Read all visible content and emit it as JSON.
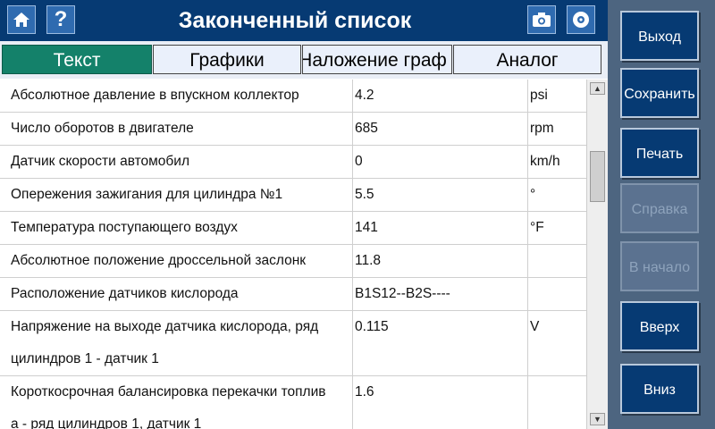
{
  "header": {
    "title": "Законченный список",
    "home_icon": "home-icon",
    "help_label": "?",
    "camera_icon": "camera-icon",
    "disc_icon": "disc-icon"
  },
  "tabs": [
    {
      "label": "Текст",
      "active": true
    },
    {
      "label": "Графики",
      "active": false
    },
    {
      "label": "Наложение граф",
      "active": false
    },
    {
      "label": "Аналог",
      "active": false
    }
  ],
  "rows": [
    {
      "name": [
        "Абсолютное давление в впускном коллектор"
      ],
      "value": "4.2",
      "unit": "psi"
    },
    {
      "name": [
        "Число оборотов в двигателе"
      ],
      "value": "685",
      "unit": "rpm"
    },
    {
      "name": [
        "Датчик скорости автомобил"
      ],
      "value": "0",
      "unit": "km/h"
    },
    {
      "name": [
        "Опережения зажигания для цилиндра №1"
      ],
      "value": "5.5",
      "unit": "°"
    },
    {
      "name": [
        "Температура поступающего воздух"
      ],
      "value": "141",
      "unit": "°F"
    },
    {
      "name": [
        "Абсолютное положение дроссельной заслонк"
      ],
      "value": "11.8",
      "unit": ""
    },
    {
      "name": [
        "Расположение датчиков кислорода"
      ],
      "value": "B1S12--B2S----",
      "unit": ""
    },
    {
      "name": [
        "Напряжение на выходе датчика кислорода, ряд",
        "цилиндров 1 - датчик 1"
      ],
      "value": "0.115",
      "unit": "V"
    },
    {
      "name": [
        "Короткосрочная балансировка перекачки топлив",
        "а - ряд цилиндров 1, датчик 1"
      ],
      "value": "1.6",
      "unit": ""
    }
  ],
  "side_buttons": [
    {
      "label": "Выход",
      "enabled": true
    },
    {
      "label": "Сохранить",
      "enabled": true
    },
    {
      "label": "Печать",
      "enabled": true
    },
    {
      "label": "Справка",
      "enabled": false
    },
    {
      "label": "В начало",
      "enabled": false
    },
    {
      "label": "Вверх",
      "enabled": true
    },
    {
      "label": "Вниз",
      "enabled": true
    }
  ],
  "colors": {
    "header_bg": "#063a73",
    "active_tab": "#14816a",
    "side_bg": "#4d6580",
    "button_bg": "#063a73"
  }
}
